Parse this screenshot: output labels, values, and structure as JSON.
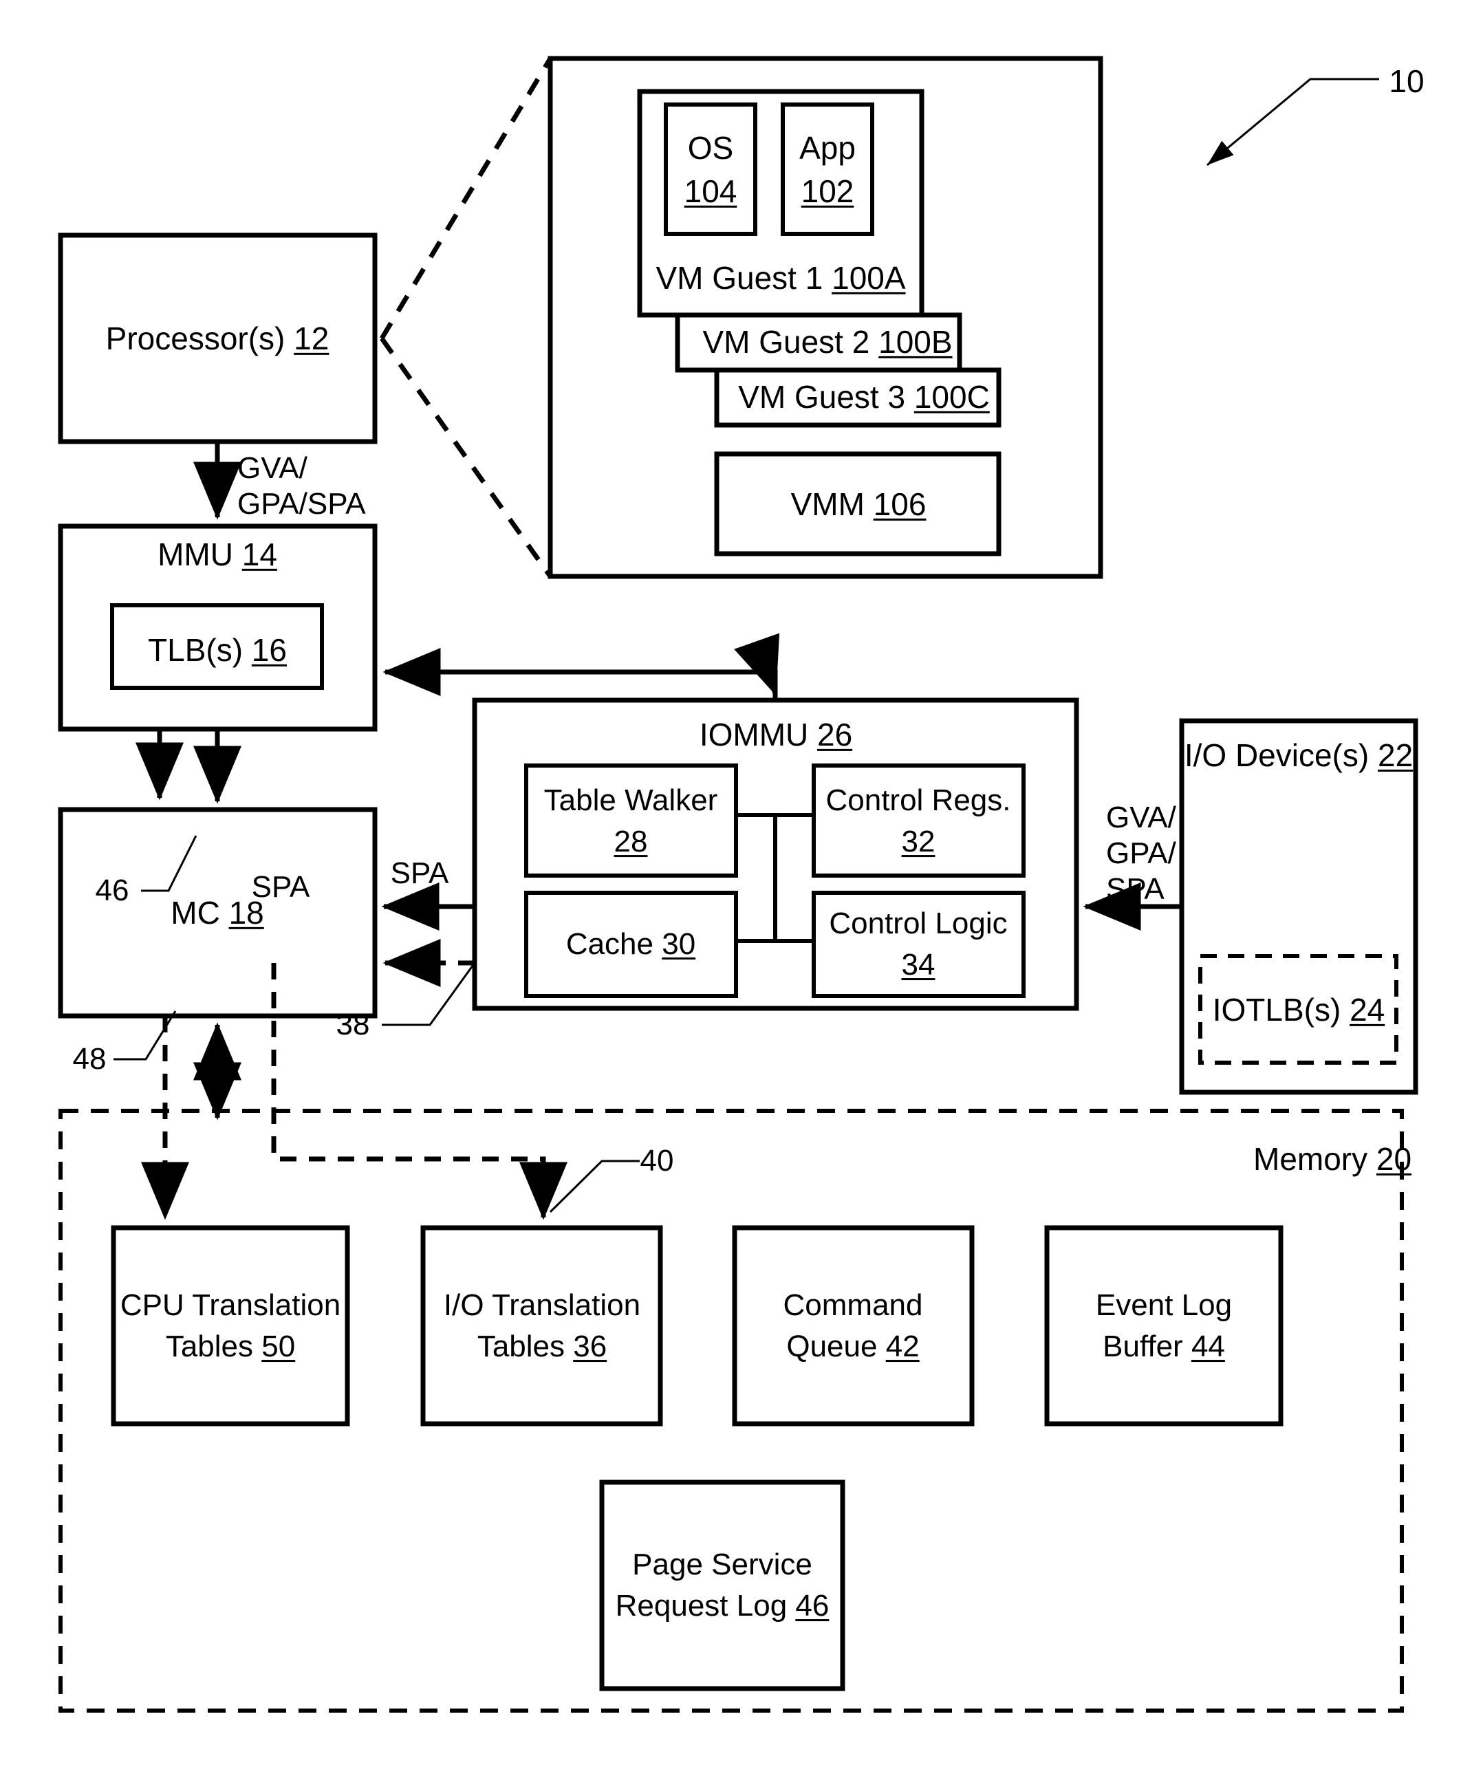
{
  "figure": {
    "reference_numeral": "10"
  },
  "processor": {
    "label": "Processor(s) ",
    "ref": "12"
  },
  "vm_system": {
    "guest1": {
      "label": "VM Guest 1 ",
      "ref": "100A",
      "os": {
        "label": "OS",
        "ref": "104"
      },
      "app": {
        "label": "App",
        "ref": "102"
      }
    },
    "guest2": {
      "label": "VM Guest 2 ",
      "ref": "100B"
    },
    "guest3": {
      "label": "VM Guest 3 ",
      "ref": "100C"
    },
    "vmm": {
      "label": "VMM ",
      "ref": "106"
    }
  },
  "mmu": {
    "label": "MMU ",
    "ref": "14",
    "tlb": {
      "label": "TLB(s) ",
      "ref": "16"
    }
  },
  "mc": {
    "label": "MC ",
    "ref": "18"
  },
  "iommu": {
    "label": "IOMMU ",
    "ref": "26",
    "table_walker": {
      "line1": "Table Walker",
      "ref": "28"
    },
    "cache": {
      "label": "Cache ",
      "ref": "30"
    },
    "control_regs": {
      "line1": "Control Regs.",
      "ref": "32"
    },
    "control_logic": {
      "line1": "Control Logic",
      "ref": "34"
    }
  },
  "io_device": {
    "label": "I/O Device(s) ",
    "ref": "22",
    "iotlb": {
      "label": "IOTLB(s) ",
      "ref": "24"
    }
  },
  "memory": {
    "label": "Memory ",
    "ref": "20",
    "cpu_translation_tables": {
      "line1": "CPU Translation",
      "line2": "Tables ",
      "ref": "50"
    },
    "io_translation_tables": {
      "line1": "I/O Translation",
      "line2": "Tables ",
      "ref": "36"
    },
    "command_queue": {
      "line1": "Command",
      "line2": "Queue ",
      "ref": "42"
    },
    "event_log_buffer": {
      "line1": "Event Log",
      "line2": "Buffer ",
      "ref": "44"
    },
    "page_service_request_log": {
      "line1": "Page Service",
      "line2": "Request Log ",
      "ref": "46"
    }
  },
  "edge_labels": {
    "proc_to_mmu_line1": "GVA/",
    "proc_to_mmu_line2": "GPA/SPA",
    "mmu_to_mc_spa": "SPA",
    "iommu_to_mc_spa": "SPA",
    "io_to_iommu_line1": "GVA/",
    "io_to_iommu_line2": "GPA/",
    "io_to_iommu_line3": "SPA",
    "ref_46": "46",
    "ref_48": "48",
    "ref_38": "38",
    "ref_40": "40"
  },
  "colors": {
    "stroke": "#000000",
    "background": "#ffffff"
  }
}
